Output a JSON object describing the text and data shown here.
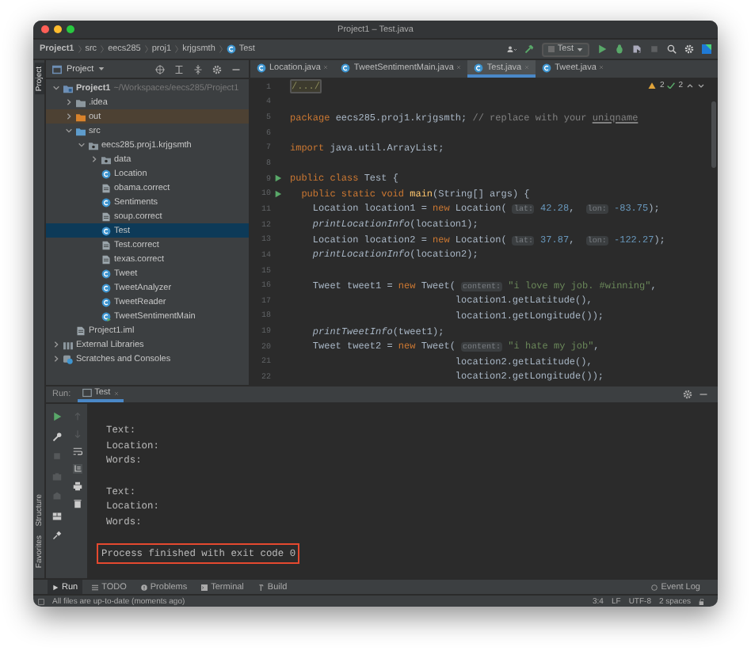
{
  "window": {
    "title": "Project1 – Test.java"
  },
  "breadcrumbs": [
    "Project1",
    "src",
    "eecs285",
    "proj1",
    "krjgsmth",
    "Test"
  ],
  "run_config": {
    "label": "Test"
  },
  "tool_strip": {
    "top": [
      "Project"
    ],
    "bottom": [
      "Structure",
      "Favorites"
    ]
  },
  "project_panel": {
    "title": "Project"
  },
  "editor_tabs": [
    {
      "label": "Location.java",
      "selected": false
    },
    {
      "label": "TweetSentimentMain.java",
      "selected": false
    },
    {
      "label": "Test.java",
      "selected": true
    },
    {
      "label": "Tweet.java",
      "selected": false
    }
  ],
  "tree": [
    {
      "kind": "module",
      "name": "Project1",
      "path": "~/Workspaces/eecs285/Project1",
      "expanded": true,
      "selected": false,
      "children": [
        {
          "kind": "folder",
          "name": ".idea",
          "expanded": false,
          "selected": false
        },
        {
          "kind": "excluded-folder",
          "name": "out",
          "expanded": false,
          "selected": false
        },
        {
          "kind": "source-folder",
          "name": "src",
          "expanded": true,
          "selected": false,
          "children": [
            {
              "kind": "package",
              "name": "eecs285.proj1.krjgsmth",
              "expanded": true,
              "selected": false,
              "children": [
                {
                  "kind": "package",
                  "name": "data",
                  "expanded": false,
                  "selected": false
                },
                {
                  "kind": "class",
                  "name": "Location",
                  "selected": false
                },
                {
                  "kind": "text-file",
                  "name": "obama.correct",
                  "selected": false
                },
                {
                  "kind": "class",
                  "name": "Sentiments",
                  "selected": false
                },
                {
                  "kind": "text-file",
                  "name": "soup.correct",
                  "selected": false
                },
                {
                  "kind": "class",
                  "name": "Test",
                  "selected": true
                },
                {
                  "kind": "text-file",
                  "name": "Test.correct",
                  "selected": false
                },
                {
                  "kind": "text-file",
                  "name": "texas.correct",
                  "selected": false
                },
                {
                  "kind": "class",
                  "name": "Tweet",
                  "selected": false
                },
                {
                  "kind": "class",
                  "name": "TweetAnalyzer",
                  "selected": false
                },
                {
                  "kind": "class",
                  "name": "TweetReader",
                  "selected": false
                },
                {
                  "kind": "main-class",
                  "name": "TweetSentimentMain",
                  "selected": false
                }
              ]
            }
          ]
        },
        {
          "kind": "module-file",
          "name": "Project1.iml",
          "selected": false
        }
      ]
    },
    {
      "kind": "libraries",
      "name": "External Libraries",
      "expanded": false,
      "selected": false
    },
    {
      "kind": "scratches",
      "name": "Scratches and Consoles",
      "expanded": false,
      "selected": false
    }
  ],
  "inspections": {
    "warnings": "2",
    "typos": "2"
  },
  "code": [
    {
      "number": "1",
      "run": false,
      "tokens": [
        {
          "kind": "fold",
          "text": "/.../"
        }
      ]
    },
    {
      "number": "4",
      "run": false
    },
    {
      "number": "5",
      "run": false,
      "tokens": [
        {
          "kind": "kw",
          "text": "package "
        },
        {
          "kind": "plain",
          "text": "eecs285.proj1.krjgsmth; "
        },
        {
          "kind": "comment",
          "text": "// replace with your "
        },
        {
          "kind": "underline",
          "text": "uniqname"
        }
      ]
    },
    {
      "number": "6",
      "run": false
    },
    {
      "number": "7",
      "run": false,
      "tokens": [
        {
          "kind": "kw",
          "text": "import "
        },
        {
          "kind": "plain",
          "text": "java.util.ArrayList;"
        }
      ]
    },
    {
      "number": "8",
      "run": false
    },
    {
      "number": "9",
      "run": true,
      "tokens": [
        {
          "kind": "kw",
          "text": "public class "
        },
        {
          "kind": "plain",
          "text": "Test {"
        }
      ]
    },
    {
      "number": "10",
      "run": true,
      "tokens": [
        {
          "kind": "kw",
          "text": "  public static void "
        },
        {
          "kind": "method",
          "text": "main"
        },
        {
          "kind": "plain",
          "text": "(String[] args) {"
        }
      ]
    },
    {
      "number": "11",
      "run": false,
      "tokens": [
        {
          "kind": "plain",
          "text": "    Location location1 = "
        },
        {
          "kind": "kw",
          "text": "new "
        },
        {
          "kind": "plain",
          "text": "Location( "
        },
        {
          "kind": "hint",
          "text": "lat:"
        },
        {
          "kind": "num",
          "text": " 42.28"
        },
        {
          "kind": "plain",
          "text": ",  "
        },
        {
          "kind": "hint",
          "text": "lon:"
        },
        {
          "kind": "num",
          "text": " -83.75"
        },
        {
          "kind": "plain",
          "text": ");"
        }
      ]
    },
    {
      "number": "12",
      "run": false,
      "tokens": [
        {
          "kind": "italic",
          "text": "    printLocationInfo"
        },
        {
          "kind": "plain",
          "text": "(location1);"
        }
      ]
    },
    {
      "number": "13",
      "run": false,
      "tokens": [
        {
          "kind": "plain",
          "text": "    Location location2 = "
        },
        {
          "kind": "kw",
          "text": "new "
        },
        {
          "kind": "plain",
          "text": "Location( "
        },
        {
          "kind": "hint",
          "text": "lat:"
        },
        {
          "kind": "num",
          "text": " 37.87"
        },
        {
          "kind": "plain",
          "text": ",  "
        },
        {
          "kind": "hint",
          "text": "lon:"
        },
        {
          "kind": "num",
          "text": " -122.27"
        },
        {
          "kind": "plain",
          "text": ");"
        }
      ]
    },
    {
      "number": "14",
      "run": false,
      "tokens": [
        {
          "kind": "italic",
          "text": "    printLocationInfo"
        },
        {
          "kind": "plain",
          "text": "(location2);"
        }
      ]
    },
    {
      "number": "15",
      "run": false
    },
    {
      "number": "16",
      "run": false,
      "tokens": [
        {
          "kind": "plain",
          "text": "    Tweet tweet1 = "
        },
        {
          "kind": "kw",
          "text": "new "
        },
        {
          "kind": "plain",
          "text": "Tweet( "
        },
        {
          "kind": "hint",
          "text": "content:"
        },
        {
          "kind": "str",
          "text": " \"i love my job. #winning\""
        },
        {
          "kind": "plain",
          "text": ","
        }
      ]
    },
    {
      "number": "17",
      "run": false,
      "tokens": [
        {
          "kind": "plain",
          "text": "                             location1.getLatitude(),"
        }
      ]
    },
    {
      "number": "18",
      "run": false,
      "tokens": [
        {
          "kind": "plain",
          "text": "                             location1.getLongitude());"
        }
      ]
    },
    {
      "number": "19",
      "run": false,
      "tokens": [
        {
          "kind": "italic",
          "text": "    printTweetInfo"
        },
        {
          "kind": "plain",
          "text": "(tweet1);"
        }
      ]
    },
    {
      "number": "20",
      "run": false,
      "tokens": [
        {
          "kind": "plain",
          "text": "    Tweet tweet2 = "
        },
        {
          "kind": "kw",
          "text": "new "
        },
        {
          "kind": "plain",
          "text": "Tweet( "
        },
        {
          "kind": "hint",
          "text": "content:"
        },
        {
          "kind": "str",
          "text": " \"i hate my job\""
        },
        {
          "kind": "plain",
          "text": ","
        }
      ]
    },
    {
      "number": "21",
      "run": false,
      "tokens": [
        {
          "kind": "plain",
          "text": "                             location2.getLatitude(),"
        }
      ]
    },
    {
      "number": "22",
      "run": false,
      "tokens": [
        {
          "kind": "plain",
          "text": "                             location2.getLongitude());"
        }
      ]
    }
  ],
  "run_panel": {
    "label": "Run:",
    "tab": "Test",
    "console": [
      {
        "kind": "output",
        "text": "Text:"
      },
      {
        "kind": "output",
        "text": "Location:"
      },
      {
        "kind": "output",
        "text": "Words:"
      },
      {
        "kind": "blank"
      },
      {
        "kind": "output",
        "text": "Text:"
      },
      {
        "kind": "output",
        "text": "Location:"
      },
      {
        "kind": "output",
        "text": "Words:"
      },
      {
        "kind": "blank"
      },
      {
        "kind": "output",
        "text": "Process finished with exit code 0",
        "highlighted": true
      }
    ]
  },
  "bottom_tabs": [
    {
      "kind": "run",
      "label": "Run",
      "selected": true
    },
    {
      "kind": "todo",
      "label": "TODO",
      "selected": false
    },
    {
      "kind": "problems",
      "label": "Problems",
      "selected": false
    },
    {
      "kind": "terminal",
      "label": "Terminal",
      "selected": false
    },
    {
      "kind": "build",
      "label": "Build",
      "selected": false
    }
  ],
  "event_log": "Event Log",
  "status_bar": {
    "message": "All files are up-to-date (moments ago)",
    "position": "3:4",
    "line_separator": "LF",
    "encoding": "UTF-8",
    "indent": "2 spaces"
  }
}
